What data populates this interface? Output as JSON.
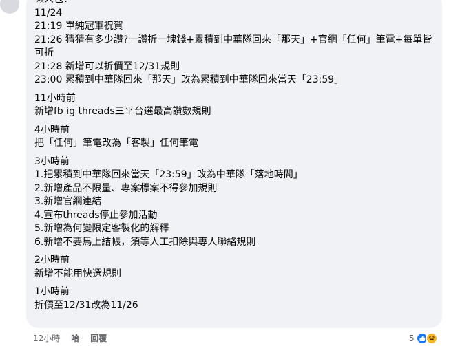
{
  "comment": {
    "lines_top": [
      "懶人包：",
      "11/24",
      "21:19 單純冠軍祝賀",
      "21:26 猜猜有多少讚?一讚折一塊錢+累積到中華隊回來「那天」+官網「任何」筆電+每單皆可折",
      "21:28 新增可以折價至12/31規則",
      "23:00 累積到中華隊回來「那天」改為累積到中華隊回來當天「23:59」"
    ],
    "block_11h": {
      "heading": "11小時前",
      "lines": [
        "新增fb ig threads三平台選最高讚數規則"
      ]
    },
    "block_4h": {
      "heading": "4小時前",
      "lines": [
        "把「任何」筆電改為「客製」任何筆電"
      ]
    },
    "block_3h": {
      "heading": "3小時前",
      "lines": [
        "1.把累積到中華隊回來當天「23:59」改為中華隊「落地時間」",
        "2.新增產品不限量、專案標案不得參加規則",
        "3.新增官網連結",
        "4.宣布threads停止參加活動",
        "5.新增為何變限定客製化的解釋",
        "6.新增不要馬上結帳，須等人工扣除與專人聯絡規則"
      ]
    },
    "block_2h": {
      "heading": "2小時前",
      "lines": [
        "新增不能用快選規則"
      ]
    },
    "block_1h": {
      "heading": "1小時前",
      "lines": [
        "折價至12/31改為11/26"
      ]
    }
  },
  "footer": {
    "timestamp": "12小時",
    "like_label": "哈",
    "reply_label": "回覆"
  },
  "reactions": {
    "count": "5",
    "icons": [
      "like-icon",
      "laugh-icon"
    ]
  }
}
